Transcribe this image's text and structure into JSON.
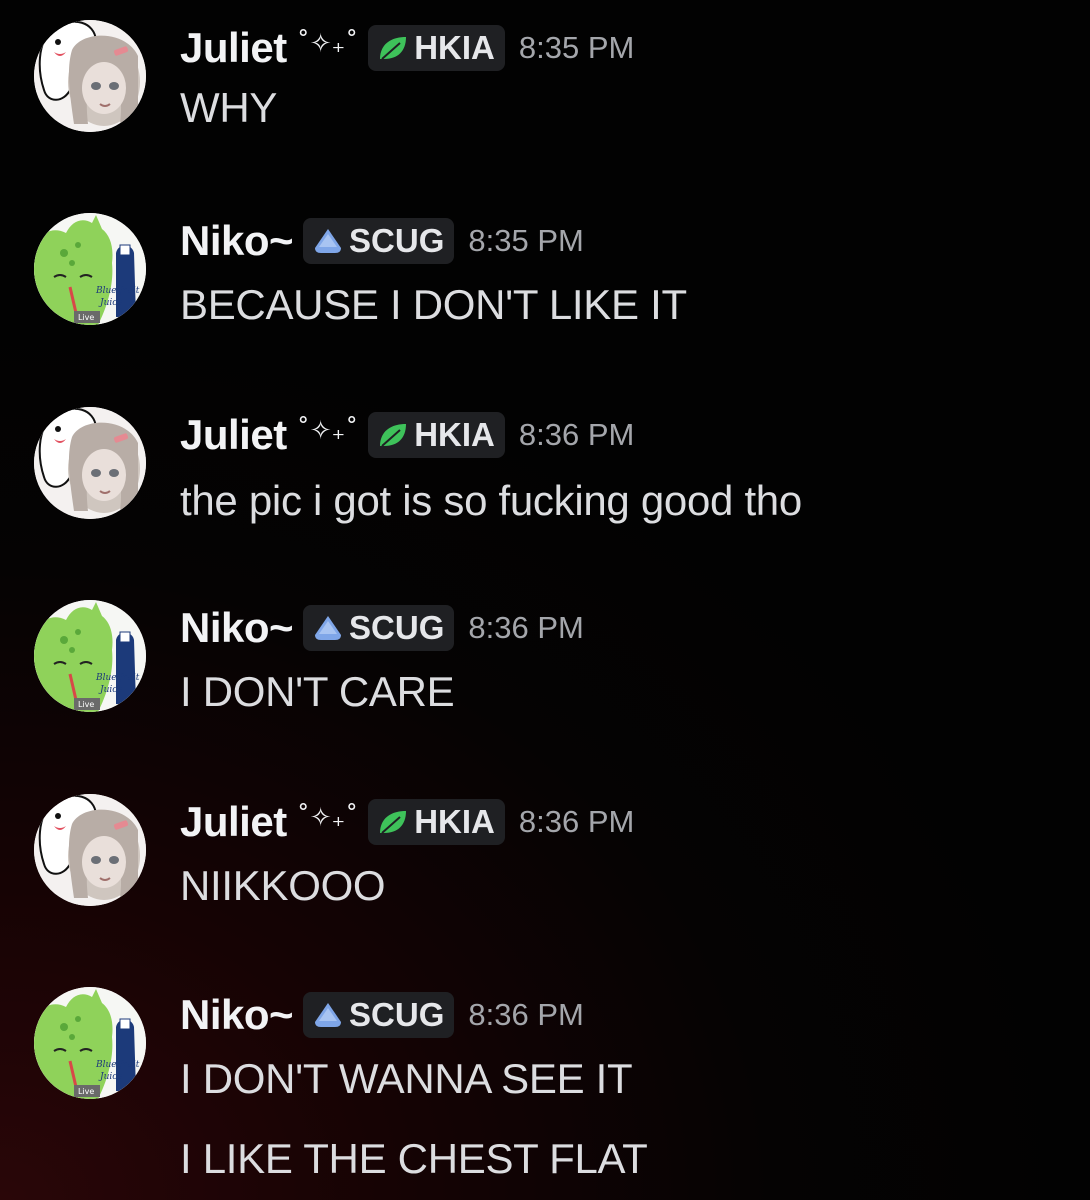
{
  "colors": {
    "background": "#050303",
    "username": "#f2f3f5",
    "message_text": "#dcdde0",
    "timestamp": "#a4a6ab",
    "tag_background": "#1f2023",
    "hkia_leaf": "#3ec25a",
    "scug_drop": "#7fa6e8"
  },
  "messages": [
    {
      "username": "Juliet",
      "decoration": "˚✧₊˚",
      "tag_label": "HKIA",
      "tag_icon": "leaf-icon",
      "time": "8:35 PM",
      "lines": [
        "WHY"
      ]
    },
    {
      "username": "Niko~",
      "decoration": "",
      "tag_label": "SCUG",
      "tag_icon": "drop-icon",
      "time": "8:35 PM",
      "lines": [
        "BECAUSE I DON'T LIKE IT"
      ]
    },
    {
      "username": "Juliet",
      "decoration": "˚✧₊˚",
      "tag_label": "HKIA",
      "tag_icon": "leaf-icon",
      "time": "8:36 PM",
      "lines": [
        "the pic i got is so fucking good tho"
      ]
    },
    {
      "username": "Niko~",
      "decoration": "",
      "tag_label": "SCUG",
      "tag_icon": "drop-icon",
      "time": "8:36 PM",
      "lines": [
        "I DON'T CARE"
      ]
    },
    {
      "username": "Juliet",
      "decoration": "˚✧₊˚",
      "tag_label": "HKIA",
      "tag_icon": "leaf-icon",
      "time": "8:36 PM",
      "lines": [
        "NIIKKOOO"
      ]
    },
    {
      "username": "Niko~",
      "decoration": "",
      "tag_label": "SCUG",
      "tag_icon": "drop-icon",
      "time": "8:36 PM",
      "lines": [
        "I DON'T WANNA SEE IT",
        "I LIKE THE CHEST FLAT"
      ]
    }
  ],
  "avatars": {
    "juliet": {
      "icon": "juliet-avatar-icon"
    },
    "niko": {
      "icon": "niko-avatar-icon",
      "badge_text": "Live",
      "bottle_text_1": "Blue fruit",
      "bottle_text_2": "Juice"
    }
  }
}
